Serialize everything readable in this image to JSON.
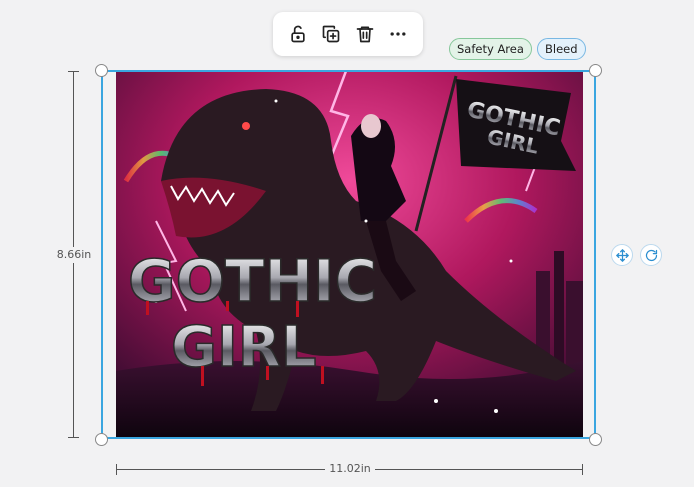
{
  "toolbar": {
    "actions": [
      {
        "name": "unlock",
        "icon": "unlock-icon"
      },
      {
        "name": "duplicate",
        "icon": "duplicate-icon"
      },
      {
        "name": "delete",
        "icon": "trash-icon"
      },
      {
        "name": "more",
        "icon": "more-horizontal-icon"
      }
    ]
  },
  "badges": {
    "safety_area": "Safety Area",
    "bleed": "Bleed"
  },
  "dimensions": {
    "height": "8.66in",
    "width": "11.02in"
  },
  "artwork": {
    "title_line1": "GOTHIC",
    "title_line2": "GIRL",
    "flag_line1": "GOTHIC",
    "flag_line2": "GIRL"
  },
  "side_controls": [
    {
      "name": "move",
      "icon": "move-icon"
    },
    {
      "name": "rotate",
      "icon": "rotate-icon"
    }
  ],
  "colors": {
    "selection": "#3aa6e0",
    "safety_border": "#86c79a",
    "bleed_border": "#79b8e3",
    "sky_pink": "#e0287a",
    "sky_dark": "#2a0a2a"
  }
}
